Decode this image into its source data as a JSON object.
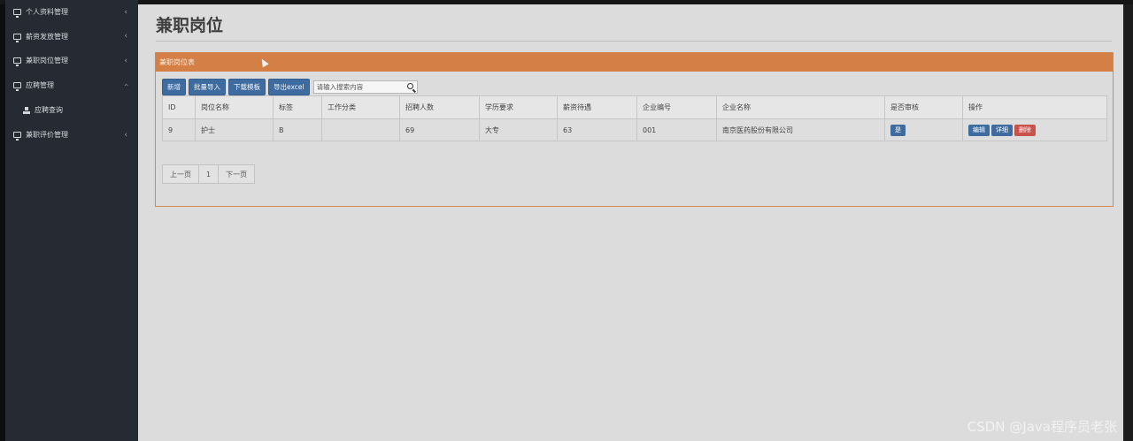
{
  "sidebar": {
    "items": [
      {
        "label": "个人资料管理"
      },
      {
        "label": "薪资发放管理"
      },
      {
        "label": "兼职岗位管理"
      },
      {
        "label": "应聘管理"
      },
      {
        "label": "应聘查询"
      },
      {
        "label": "兼职评价管理"
      }
    ]
  },
  "page": {
    "title": "兼职岗位"
  },
  "panel": {
    "title": "兼职岗位表"
  },
  "toolbar": {
    "add": "新增",
    "batch_import": "批量导入",
    "download_template": "下载模板",
    "export_excel": "导出excel",
    "search_placeholder": "请输入搜索内容"
  },
  "table": {
    "headers": [
      "ID",
      "岗位名称",
      "标签",
      "工作分类",
      "招聘人数",
      "学历要求",
      "薪资待遇",
      "企业编号",
      "企业名称",
      "是否审核",
      "操作"
    ],
    "rows": [
      {
        "id": "9",
        "name": "护士",
        "tag": "B",
        "category": "",
        "count": "69",
        "education": "大专",
        "salary": "63",
        "company_no": "001",
        "company_name": "南京医药股份有限公司",
        "audited": "是",
        "edit": "编辑",
        "detail": "详细",
        "delete": "删除"
      }
    ]
  },
  "pager": {
    "prev": "上一页",
    "page": "1",
    "next": "下一页"
  },
  "watermark": "CSDN @Java程序员老张"
}
